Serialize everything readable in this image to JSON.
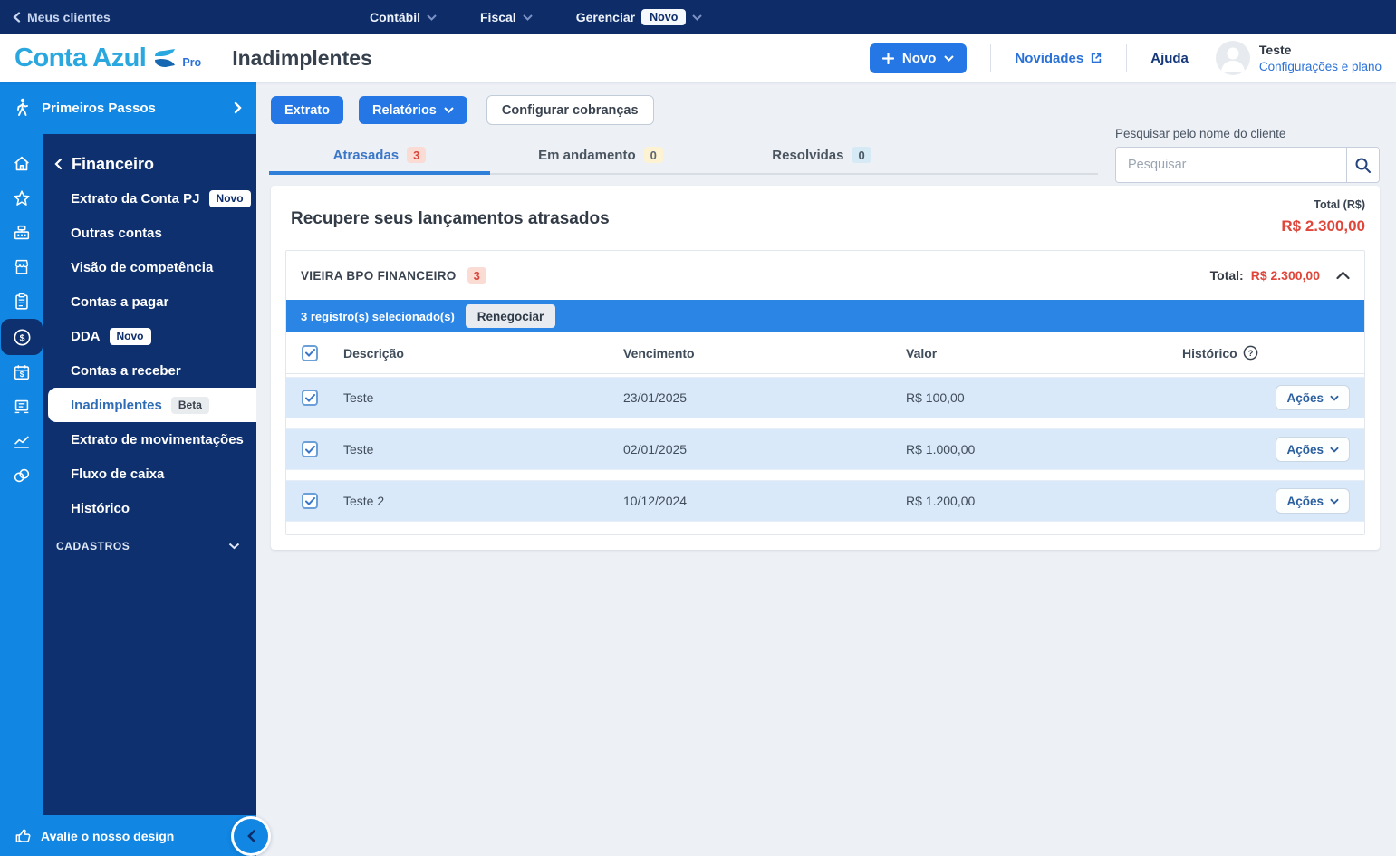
{
  "topbar": {
    "back_label": "Meus clientes",
    "menu_contabil": "Contábil",
    "menu_fiscal": "Fiscal",
    "menu_gerenciar": "Gerenciar",
    "gerenciar_badge": "Novo"
  },
  "header": {
    "logo_text": "Conta Azul",
    "logo_pro": "Pro",
    "page_title": "Inadimplentes",
    "novo_button_label": "Novo",
    "novidades_label": "Novidades",
    "ajuda_label": "Ajuda",
    "user_name": "Teste",
    "user_settings": "Configurações e plano"
  },
  "sidebar": {
    "primeiros_passos": "Primeiros Passos",
    "section_title": "Financeiro",
    "items": [
      {
        "label": "Extrato da Conta PJ",
        "badge": "Novo"
      },
      {
        "label": "Outras contas"
      },
      {
        "label": "Visão de competência"
      },
      {
        "label": "Contas a pagar"
      },
      {
        "label": "DDA",
        "badge": "Novo"
      },
      {
        "label": "Contas a receber"
      },
      {
        "label": "Inadimplentes",
        "badge": "Beta"
      },
      {
        "label": "Extrato de movimentações"
      },
      {
        "label": "Fluxo de caixa"
      },
      {
        "label": "Histórico"
      }
    ],
    "cadastros_label": "CADASTROS",
    "footer_label": "Avalie o nosso design"
  },
  "toolbar": {
    "extrato_label": "Extrato",
    "relatorios_label": "Relatórios",
    "configurar_label": "Configurar cobranças"
  },
  "search": {
    "label": "Pesquisar pelo nome do cliente",
    "placeholder": "Pesquisar"
  },
  "tabs": [
    {
      "label": "Atrasadas",
      "count": "3"
    },
    {
      "label": "Em andamento",
      "count": "0"
    },
    {
      "label": "Resolvidas",
      "count": "0"
    }
  ],
  "card": {
    "title": "Recupere seus lançamentos atrasados",
    "total_label": "Total (R$)",
    "total_value": "R$ 2.300,00",
    "group": {
      "name": "VIEIRA BPO FINANCEIRO",
      "count": "3",
      "total_label": "Total:",
      "total_value": "R$ 2.300,00"
    },
    "selection": {
      "text": "3 registro(s) selecionado(s)",
      "renegociar_label": "Renegociar"
    },
    "table": {
      "col_descricao": "Descrição",
      "col_vencimento": "Vencimento",
      "col_valor": "Valor",
      "col_historico": "Histórico",
      "rows": [
        {
          "descricao": "Teste",
          "vencimento": "23/01/2025",
          "valor": "R$ 100,00",
          "acoes_label": "Ações"
        },
        {
          "descricao": "Teste",
          "vencimento": "02/01/2025",
          "valor": "R$ 1.000,00",
          "acoes_label": "Ações"
        },
        {
          "descricao": "Teste 2",
          "vencimento": "10/12/2024",
          "valor": "R$ 1.200,00",
          "acoes_label": "Ações"
        }
      ]
    }
  },
  "colors": {
    "navy": "#0d2c68",
    "brand_blue": "#1186e2",
    "action_blue": "#2577e5",
    "alert_red": "#e0463a",
    "row_blue": "#d9e9f9"
  }
}
